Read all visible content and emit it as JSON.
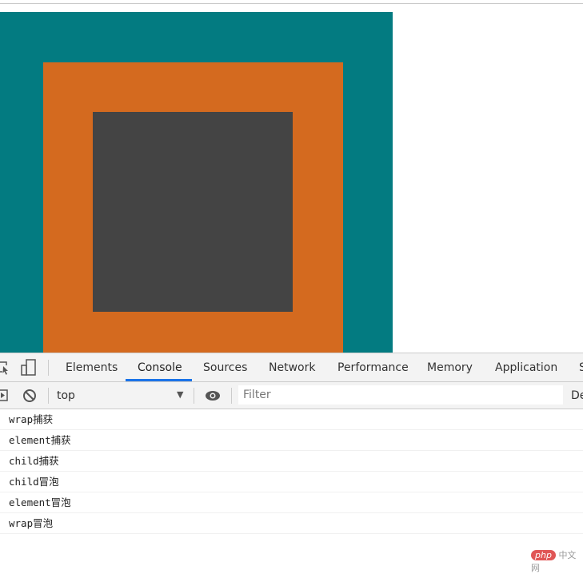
{
  "boxes": {
    "wrap_color": "#037b81",
    "element_color": "#d46a1f",
    "child_color": "#444444"
  },
  "devtools": {
    "tabs": [
      "Elements",
      "Console",
      "Sources",
      "Network",
      "Performance",
      "Memory",
      "Application",
      "S"
    ],
    "active_tab": "Console",
    "context": "top",
    "filter_placeholder": "Filter",
    "levels_label": "De",
    "logs": [
      "wrap捕获",
      "element捕获",
      "child捕获",
      "child冒泡",
      "element冒泡",
      "wrap冒泡"
    ]
  },
  "watermark": {
    "logo": "php",
    "text": "中文网"
  }
}
